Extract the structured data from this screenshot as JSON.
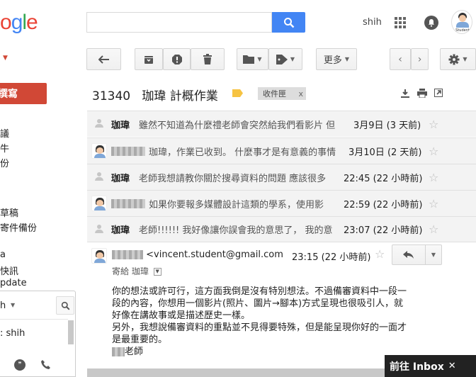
{
  "header": {
    "logo_text": "ogle",
    "search_placeholder": "",
    "user_name": "shih",
    "avatar_caption": "Student"
  },
  "toolbar": {
    "more_label": "更多"
  },
  "sidebar": {
    "compose_label": "撰寫",
    "items": [
      "議",
      "牛",
      "份",
      "草稿",
      "寄件備份",
      "a",
      "快訊",
      "pdate"
    ],
    "hangouts_search": "h",
    "hangouts_user": "shih"
  },
  "thread": {
    "title_count": "31340",
    "title": "珈瑋 計概作業",
    "label_tag": "收件匣",
    "label_close": "x"
  },
  "messages": [
    {
      "sender": "珈瑋",
      "snippet": "雖然不知道為什麼禮老師會突然給我們看影片 但",
      "date": "3月9日 (3 天前)"
    },
    {
      "sender": "",
      "snippet": "珈瑋，作業已收到。 什麼事才是有意義的事情",
      "date": "3月10日 (2 天前)"
    },
    {
      "sender": "珈瑋",
      "snippet": "老師我想請教你關於搜尋資料的問題 應該很多",
      "date": "22:45 (22 小時前)"
    },
    {
      "sender": "",
      "snippet": "如果你要報多媒體設計這類的學系，使用影",
      "date": "22:59 (22 小時前)"
    },
    {
      "sender": "珈瑋",
      "snippet": "老師!!!!!! 我好像讓你誤會我的意思了， 我的意",
      "date": "23:07 (22 小時前)"
    }
  ],
  "open_message": {
    "from_email": "<vincent.student@gmail.com",
    "time": "23:15 (22 小時前)",
    "to_line": "寄給 珈瑋",
    "body": [
      "你的想法或許可行，這方面我倒是沒有特別想法。不過備審資料中一段一",
      "段的內容，你想用一個影片(照片、圖片→腳本)方式呈現也很吸引人，就",
      "好像在講故事或是描述歷史一樣。",
      "另外，我想說備審資料的重點並不見得要特殊，但是能呈現你好的一面才",
      "是最重要的。"
    ],
    "signature": "老師"
  },
  "go_inbox": {
    "label": "前往 Inbox",
    "close": "✕"
  },
  "colors": {
    "compose_red": "#d14836",
    "search_blue": "#4285f4",
    "label_yellow": "#f6c342"
  }
}
